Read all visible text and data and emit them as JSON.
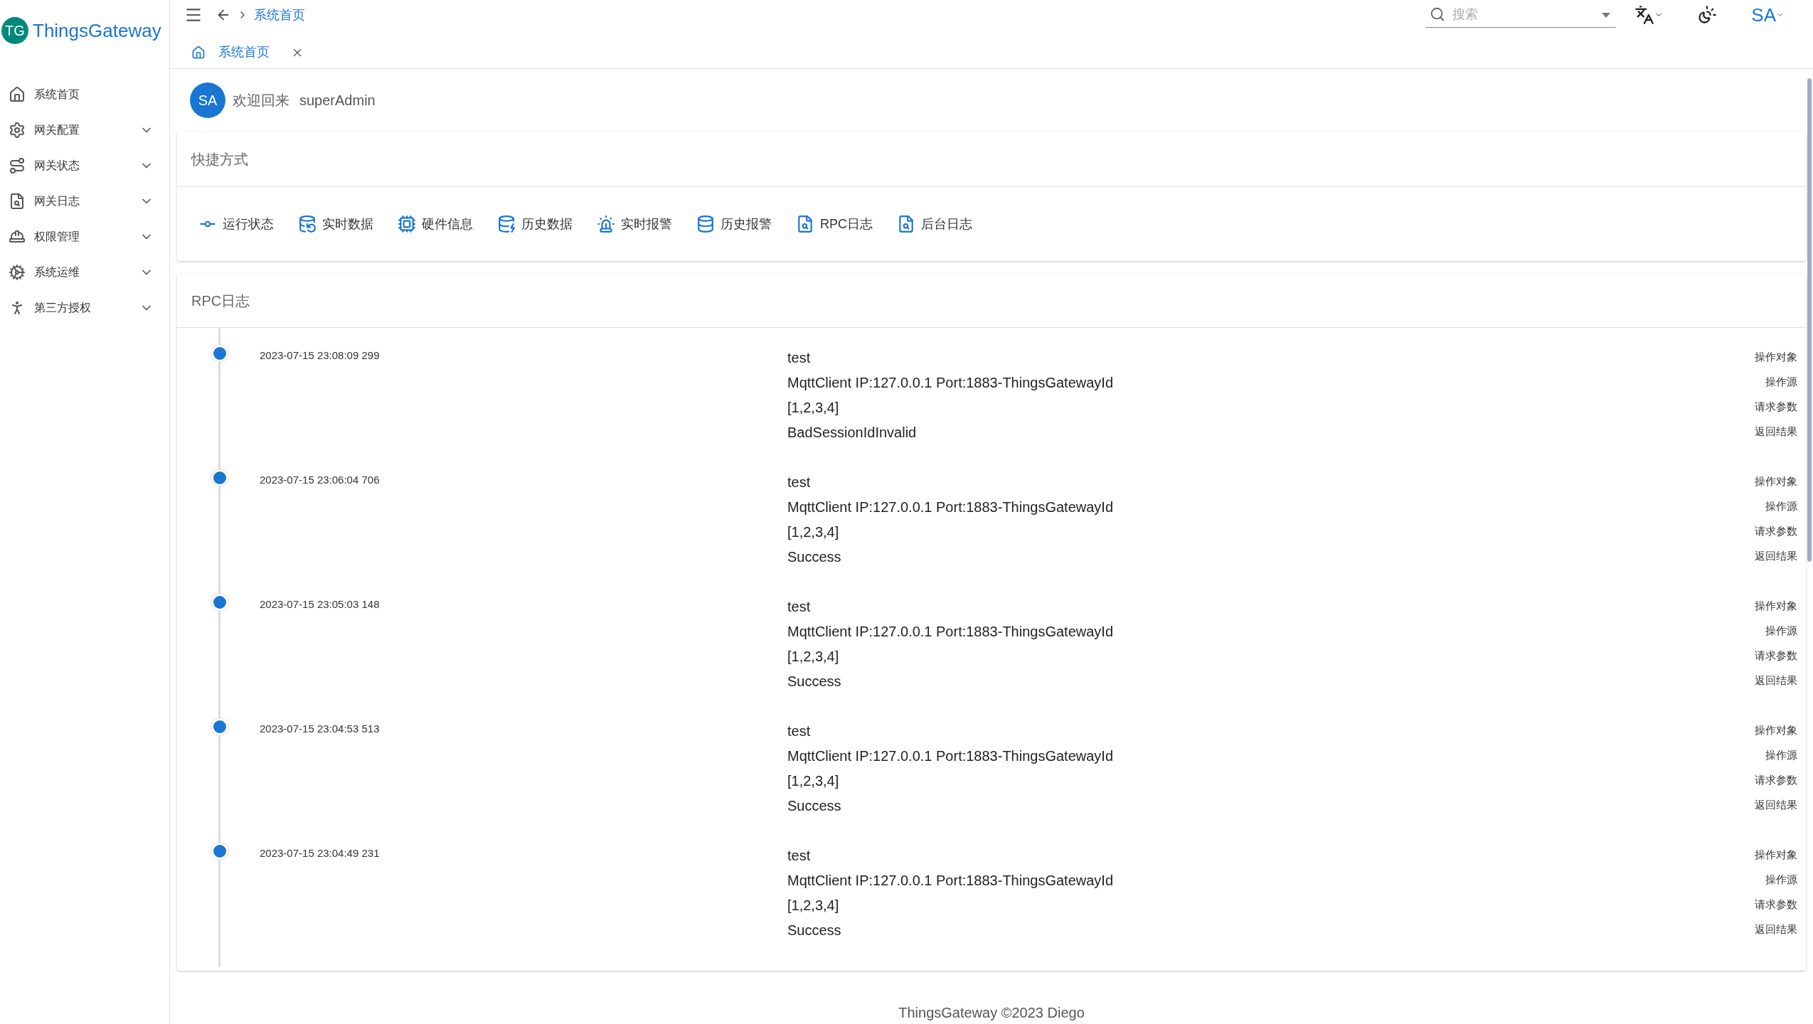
{
  "brand": {
    "logo": "TG",
    "name": "ThingsGateway"
  },
  "header": {
    "breadcrumb": "系统首页",
    "search": {
      "placeholder": "搜索"
    },
    "user": "SA"
  },
  "tabs": [
    {
      "label": "系统首页",
      "selected": true
    }
  ],
  "sidebar": {
    "items": [
      {
        "label": "系统首页",
        "kind": "link",
        "expanded": false
      },
      {
        "label": "网关配置",
        "kind": "group",
        "expanded": false
      },
      {
        "label": "网关状态",
        "kind": "group",
        "expanded": false
      },
      {
        "label": "网关日志",
        "kind": "group",
        "expanded": false
      },
      {
        "label": "权限管理",
        "kind": "group",
        "expanded": false
      },
      {
        "label": "系统运维",
        "kind": "group",
        "expanded": false
      },
      {
        "label": "第三方授权",
        "kind": "group",
        "expanded": false
      }
    ]
  },
  "welcome": {
    "avatar": "SA",
    "greeting": "欢迎回来",
    "user": "superAdmin"
  },
  "shortcuts": {
    "title": "快捷方式",
    "items": [
      "运行状态",
      "实时数据",
      "硬件信息",
      "历史数据",
      "实时报警",
      "历史报警",
      "RPC日志",
      "后台日志"
    ]
  },
  "rpc_log": {
    "title": "RPC日志",
    "entries": [
      {
        "time": "2023-07-15 23:08:09 299",
        "fields": [
          {
            "label": "操作对象",
            "value": "test"
          },
          {
            "label": "操作源",
            "value": "MqttClient IP:127.0.0.1 Port:1883-ThingsGatewayId"
          },
          {
            "label": "请求参数",
            "value": "[1,2,3,4]"
          },
          {
            "label": "返回结果",
            "value": "BadSessionIdInvalid"
          }
        ]
      },
      {
        "time": "2023-07-15 23:06:04 706",
        "fields": [
          {
            "label": "操作对象",
            "value": "test"
          },
          {
            "label": "操作源",
            "value": "MqttClient IP:127.0.0.1 Port:1883-ThingsGatewayId"
          },
          {
            "label": "请求参数",
            "value": "[1,2,3,4]"
          },
          {
            "label": "返回结果",
            "value": "Success"
          }
        ]
      },
      {
        "time": "2023-07-15 23:05:03 148",
        "fields": [
          {
            "label": "操作对象",
            "value": "test"
          },
          {
            "label": "操作源",
            "value": "MqttClient IP:127.0.0.1 Port:1883-ThingsGatewayId"
          },
          {
            "label": "请求参数",
            "value": "[1,2,3,4]"
          },
          {
            "label": "返回结果",
            "value": "Success"
          }
        ]
      },
      {
        "time": "2023-07-15 23:04:53 513",
        "fields": [
          {
            "label": "操作对象",
            "value": "test"
          },
          {
            "label": "操作源",
            "value": "MqttClient IP:127.0.0.1 Port:1883-ThingsGatewayId"
          },
          {
            "label": "请求参数",
            "value": "[1,2,3,4]"
          },
          {
            "label": "返回结果",
            "value": "Success"
          }
        ]
      },
      {
        "time": "2023-07-15 23:04:49 231",
        "fields": [
          {
            "label": "操作对象",
            "value": "test"
          },
          {
            "label": "操作源",
            "value": "MqttClient IP:127.0.0.1 Port:1883-ThingsGatewayId"
          },
          {
            "label": "请求参数",
            "value": "[1,2,3,4]"
          },
          {
            "label": "返回结果",
            "value": "Success"
          }
        ]
      }
    ]
  },
  "footer": "ThingsGateway ©2023 Diego"
}
